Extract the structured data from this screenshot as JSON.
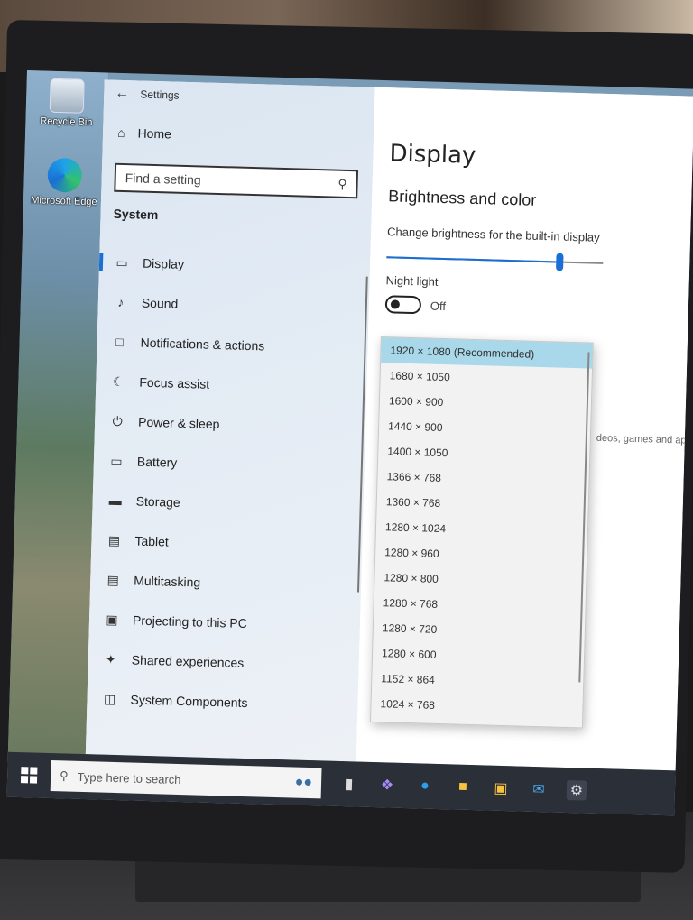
{
  "desktop": {
    "icons": [
      {
        "label": "Recycle Bin",
        "icon": "recycle-bin-icon"
      },
      {
        "label": "Microsoft Edge",
        "icon": "edge-icon"
      }
    ]
  },
  "settings": {
    "window_title": "Settings",
    "home_label": "Home",
    "search_placeholder": "Find a setting",
    "section_title": "System",
    "nav_items": [
      {
        "label": "Display",
        "icon": "monitor-icon",
        "active": true
      },
      {
        "label": "Sound",
        "icon": "speaker-icon"
      },
      {
        "label": "Notifications & actions",
        "icon": "notification-icon"
      },
      {
        "label": "Focus assist",
        "icon": "moon-icon"
      },
      {
        "label": "Power & sleep",
        "icon": "power-icon"
      },
      {
        "label": "Battery",
        "icon": "battery-icon"
      },
      {
        "label": "Storage",
        "icon": "storage-icon"
      },
      {
        "label": "Tablet",
        "icon": "tablet-icon"
      },
      {
        "label": "Multitasking",
        "icon": "multitasking-icon"
      },
      {
        "label": "Projecting to this PC",
        "icon": "projecting-icon"
      },
      {
        "label": "Shared experiences",
        "icon": "shared-icon"
      },
      {
        "label": "System Components",
        "icon": "components-icon"
      }
    ]
  },
  "display": {
    "title": "Display",
    "subtitle": "Brightness and color",
    "brightness_label": "Change brightness for the built-in display",
    "brightness_level": 0.8,
    "night_light_label": "Night light",
    "night_light_state": "Off",
    "trailing_text": "deos, games and ap"
  },
  "resolution_dropdown": {
    "selected": "1920 × 1080 (Recommended)",
    "options": [
      "1920 × 1080 (Recommended)",
      "1680 × 1050",
      "1600 × 900",
      "1440 × 900",
      "1400 × 1050",
      "1366 × 768",
      "1360 × 768",
      "1280 × 1024",
      "1280 × 960",
      "1280 × 800",
      "1280 × 768",
      "1280 × 720",
      "1280 × 600",
      "1152 × 864",
      "1024 × 768"
    ]
  },
  "taskbar": {
    "search_placeholder": "Type here to search",
    "pinned": [
      "task-view-icon",
      "copilot-icon",
      "edge-icon",
      "file-explorer-icon",
      "store-icon",
      "mail-icon",
      "settings-gear-icon"
    ]
  }
}
